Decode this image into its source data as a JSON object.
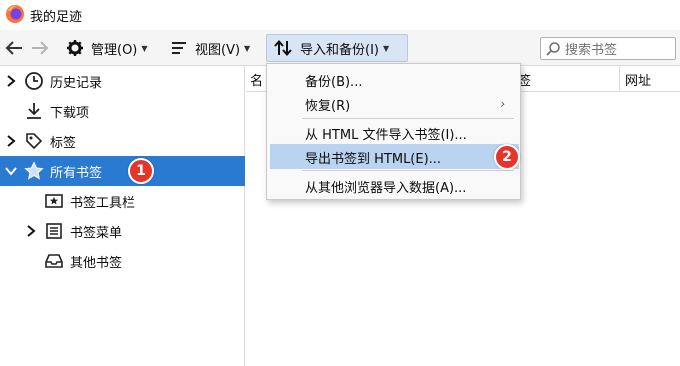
{
  "window": {
    "title": "我的足迹"
  },
  "toolbar": {
    "manage_label": "管理(O)",
    "view_label": "视图(V)",
    "import_label": "导入和备份(I)",
    "search_placeholder": "搜索书签"
  },
  "menu": {
    "items": [
      {
        "label": "备份(B)..."
      },
      {
        "label": "恢复(R)"
      },
      {
        "label": "从 HTML 文件导入书签(I)..."
      },
      {
        "label": "导出书签到 HTML(E)..."
      },
      {
        "label": "从其他浏览器导入数据(A)..."
      }
    ]
  },
  "sidebar": {
    "items": [
      {
        "label": "历史记录"
      },
      {
        "label": "下载项"
      },
      {
        "label": "标签"
      },
      {
        "label": "所有书签"
      },
      {
        "label": "书签工具栏"
      },
      {
        "label": "书签菜单"
      },
      {
        "label": "其他书签"
      }
    ]
  },
  "columns": {
    "name_partial": "名",
    "tags_partial": "签",
    "url": "网址"
  },
  "badges": [
    "1",
    "2"
  ],
  "colors": {
    "selection": "#2a7ad2",
    "badge": "#e5352a",
    "menu_highlight": "#b9d3f0"
  }
}
